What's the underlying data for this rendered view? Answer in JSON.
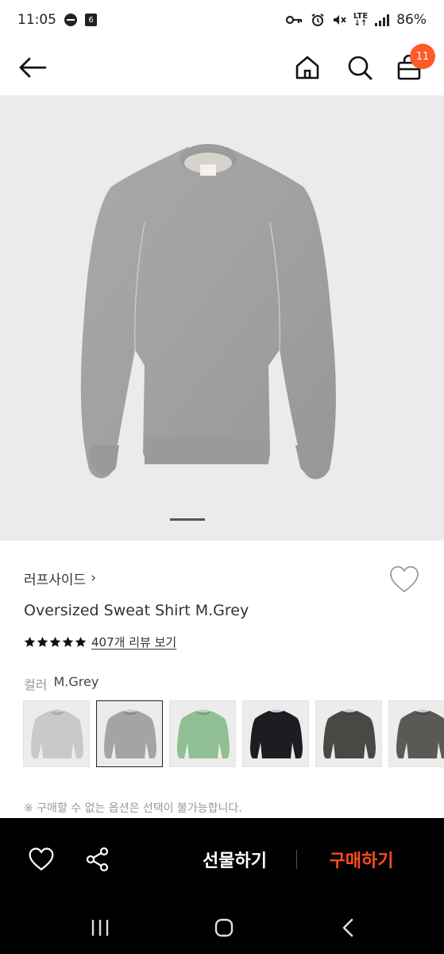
{
  "status_bar": {
    "time": "11:05",
    "calendar_day": "6",
    "network": "LTE",
    "battery": "86%"
  },
  "header": {
    "cart_count": "11"
  },
  "product": {
    "brand": "러프사이드",
    "brand_chevron": "›",
    "title": "Oversized Sweat Shirt M.Grey",
    "rating_stars": 5,
    "review_link": "407개 리뷰 보기",
    "color_label": "컬러",
    "color_value": "M.Grey",
    "image_count_indicator": "1",
    "swatches": [
      {
        "name": "light-grey",
        "color": "#c9c9c7"
      },
      {
        "name": "m-grey",
        "color": "#a4a4a4",
        "selected": true
      },
      {
        "name": "mint-green",
        "color": "#8fbf93"
      },
      {
        "name": "black",
        "color": "#1c1d22"
      },
      {
        "name": "charcoal",
        "color": "#4a4845"
      },
      {
        "name": "dark-khaki",
        "color": "#595a55"
      }
    ],
    "option_notice": "※ 구매할 수 없는 옵션은 선택이 불가능합니다."
  },
  "bottom_bar": {
    "gift_label": "선물하기",
    "buy_label": "구매하기",
    "buy_color": "#ff4d1f"
  },
  "colors": {
    "accent": "#ff5a29",
    "image_bg": "#ebebeb"
  }
}
